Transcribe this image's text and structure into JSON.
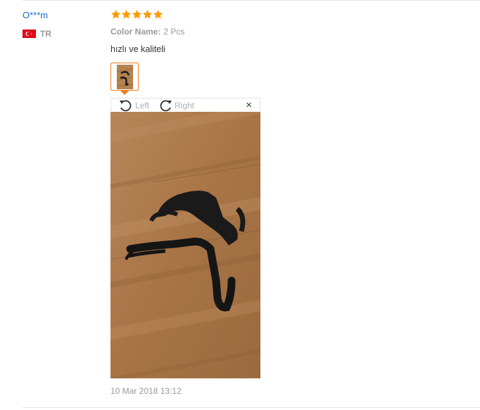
{
  "review": {
    "user_name": "O***m",
    "country_code": "TR",
    "rating": 5,
    "color_label": "Color Name:",
    "color_value": "2 Pcs",
    "text": "hızlı ve kaliteli",
    "date": "10 Mar 2018 13:12"
  },
  "viewer": {
    "rotate_left_label": "Left",
    "rotate_right_label": "Right",
    "close_symbol": "×"
  },
  "icons": {
    "star": "star-icon",
    "rotate_left": "rotate-left-icon",
    "rotate_right": "rotate-right-icon",
    "close": "close-icon",
    "flag": "turkey-flag-icon"
  },
  "colors": {
    "user_link": "#1a6fc9",
    "star": "#ff9a00",
    "thumb_border": "#f07c1e",
    "muted_text": "#999999"
  }
}
